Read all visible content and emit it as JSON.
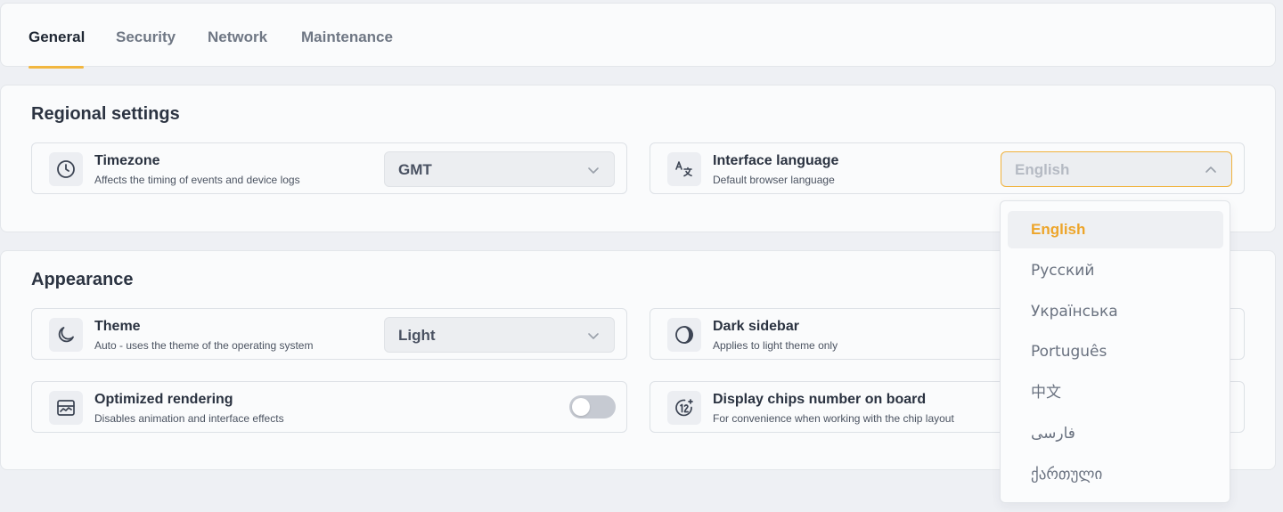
{
  "tabs": [
    {
      "label": "General",
      "active": true
    },
    {
      "label": "Security",
      "active": false
    },
    {
      "label": "Network",
      "active": false
    },
    {
      "label": "Maintenance",
      "active": false
    }
  ],
  "regional": {
    "title": "Regional settings",
    "timezone": {
      "title": "Timezone",
      "description": "Affects the timing of events and device logs",
      "value": "GMT",
      "icon": "clock-icon"
    },
    "language": {
      "title": "Interface language",
      "description": "Default browser language",
      "value": "English",
      "icon": "translate-icon",
      "open": true
    }
  },
  "appearance": {
    "title": "Appearance",
    "theme": {
      "title": "Theme",
      "description": "Auto - uses the theme of the operating system",
      "value": "Light",
      "icon": "moon-icon"
    },
    "dark_sidebar": {
      "title": "Dark sidebar",
      "description": "Applies to light theme only",
      "icon": "half-circle-icon"
    },
    "optimized_rendering": {
      "title": "Optimized rendering",
      "description": "Disables animation and interface effects",
      "enabled": false,
      "icon": "chart-icon"
    },
    "chips_number": {
      "title": "Display chips number on board",
      "description": "For convenience when working with the chip layout",
      "icon": "number-12-icon"
    }
  },
  "language_options": [
    {
      "label": "English",
      "selected": true
    },
    {
      "label": "Русский",
      "selected": false
    },
    {
      "label": "Українська",
      "selected": false
    },
    {
      "label": "Português",
      "selected": false
    },
    {
      "label": "中文",
      "selected": false
    },
    {
      "label": "فارسی",
      "selected": false
    },
    {
      "label": "ქართული",
      "selected": false
    }
  ],
  "colors": {
    "accent": "#f2b740",
    "selected_text": "#eda52a",
    "background": "#eef0f4",
    "card": "#fafbfc"
  }
}
